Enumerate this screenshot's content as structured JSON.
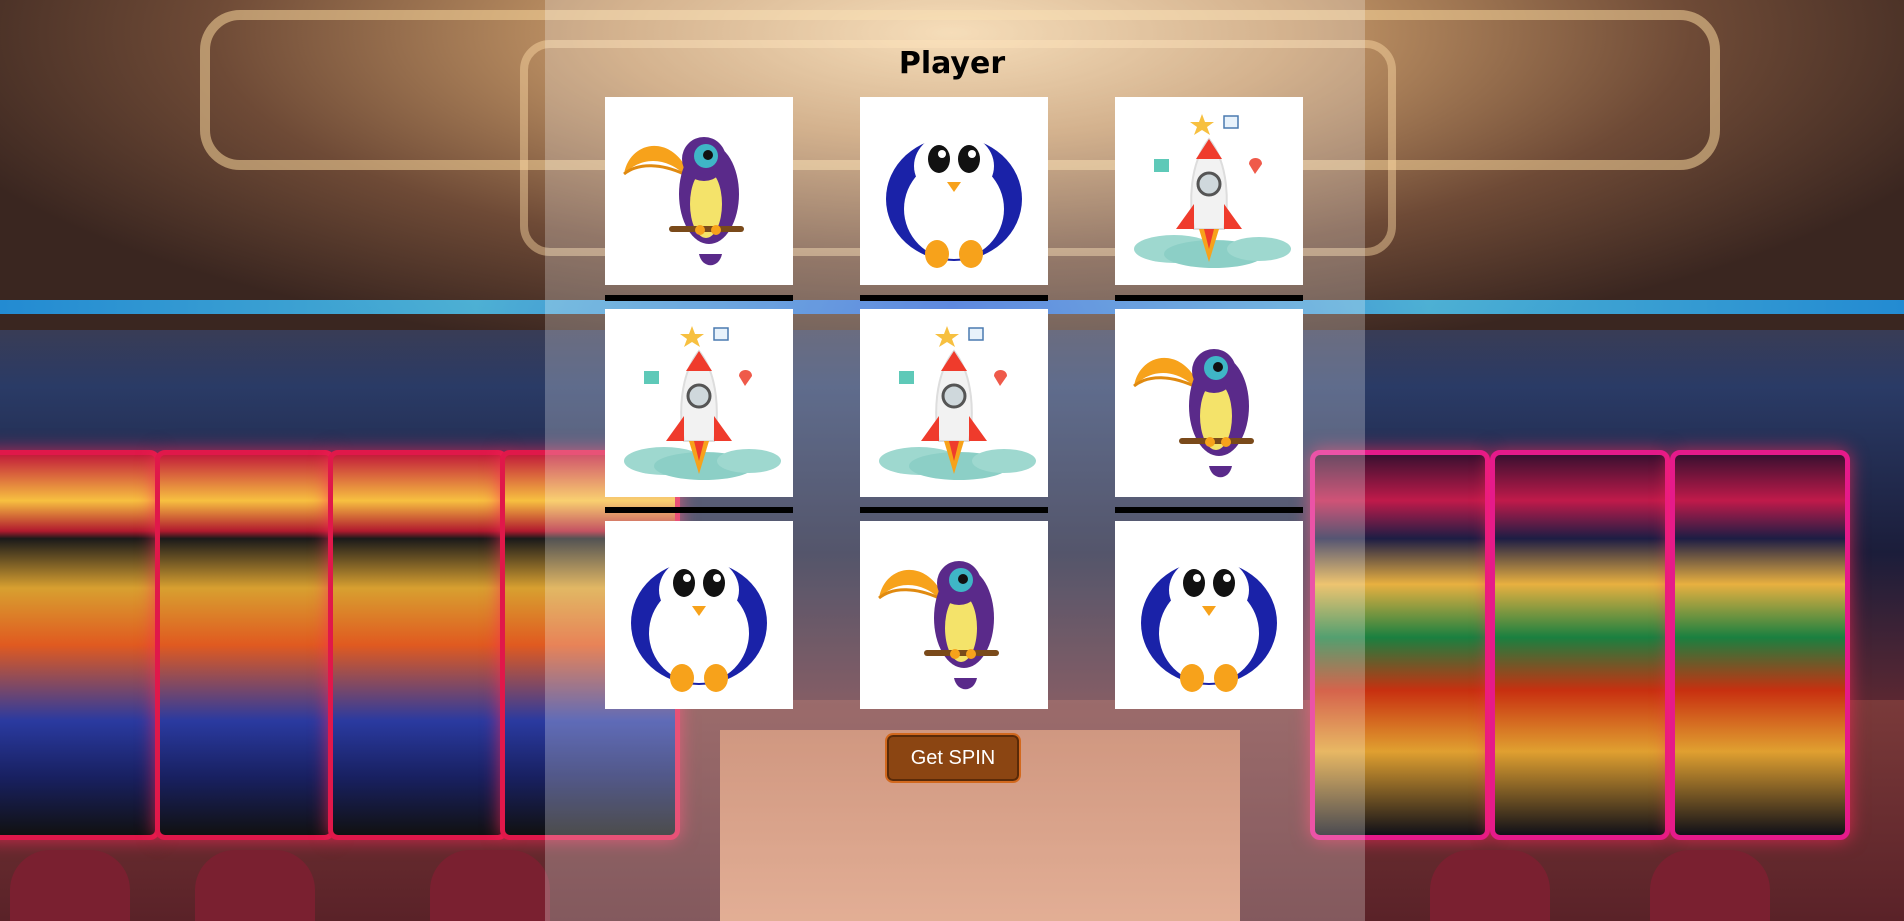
{
  "header": {
    "title": "Player"
  },
  "reels": {
    "rows": [
      [
        "toucan",
        "penguin",
        "rocket"
      ],
      [
        "rocket",
        "rocket",
        "toucan"
      ],
      [
        "penguin",
        "toucan",
        "penguin"
      ]
    ]
  },
  "controls": {
    "spin_label": "Get SPIN"
  },
  "colors": {
    "button_bg": "#8b4512",
    "button_border": "#d2691e",
    "cell_bg": "#ffffff",
    "separator": "#000000"
  }
}
